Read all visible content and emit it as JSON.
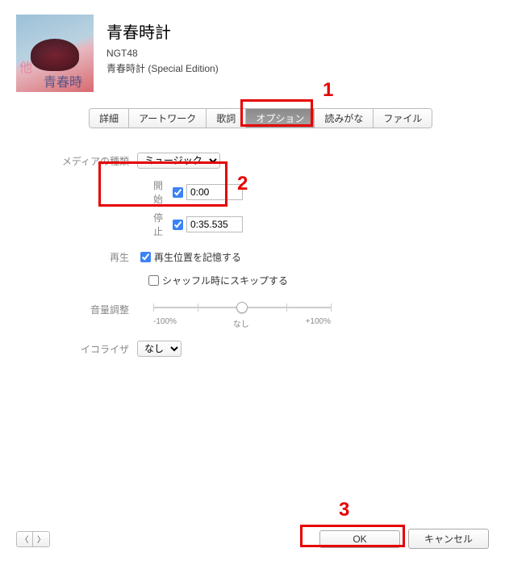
{
  "track": {
    "title": "青春時計",
    "artist": "NGT48",
    "album": "青春時計 (Special Edition)"
  },
  "tabs": {
    "details": "詳細",
    "artwork": "アートワーク",
    "lyrics": "歌詞",
    "options": "オプション",
    "reading": "読みがな",
    "file": "ファイル"
  },
  "form": {
    "media_type_label": "メディアの種類",
    "media_type_value": "ミュージック",
    "start_label": "開始",
    "start_value": "0:00",
    "stop_label": "停止",
    "stop_value": "0:35.535",
    "playback_label": "再生",
    "remember_position": "再生位置を記憶する",
    "skip_shuffle": "シャッフル時にスキップする",
    "volume_label": "音量調整",
    "volume_min": "-100%",
    "volume_mid": "なし",
    "volume_max": "+100%",
    "eq_label": "イコライザ",
    "eq_value": "なし"
  },
  "footer": {
    "ok": "OK",
    "cancel": "キャンセル"
  },
  "annotations": {
    "n1": "1",
    "n2": "2",
    "n3": "3"
  }
}
